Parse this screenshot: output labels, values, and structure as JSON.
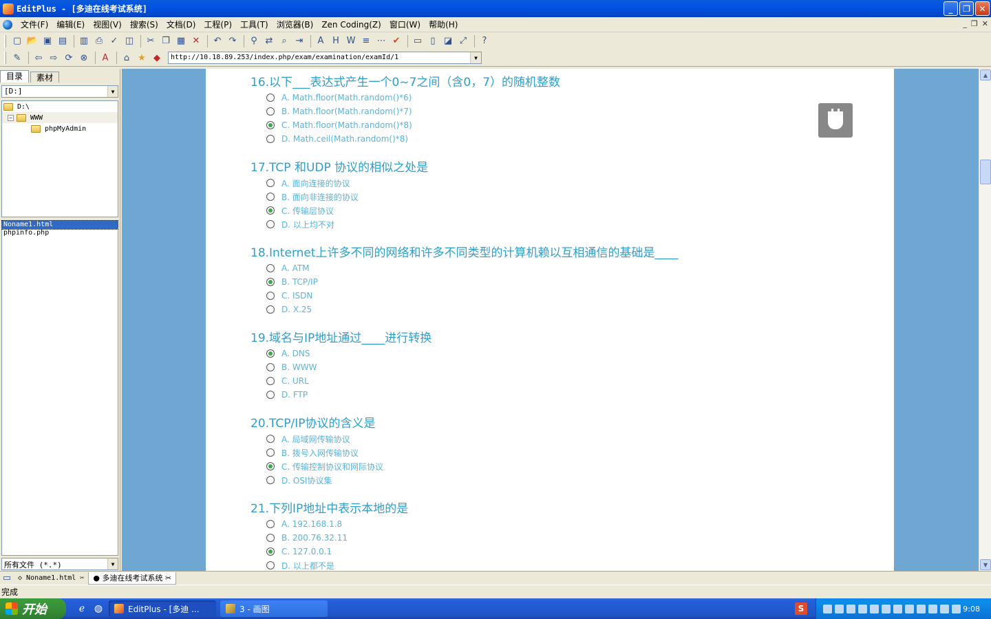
{
  "window": {
    "title": "EditPlus - [多迪在线考试系统]",
    "buttons": {
      "minimize": "_",
      "restore": "❐",
      "close": "✕"
    }
  },
  "menu": [
    "文件(F)",
    "编辑(E)",
    "视图(V)",
    "搜索(S)",
    "文档(D)",
    "工程(P)",
    "工具(T)",
    "浏览器(B)",
    "Zen Coding(Z)",
    "窗口(W)",
    "帮助(H)"
  ],
  "mdi_buttons": {
    "minimize": "_",
    "restore": "❐",
    "close": "✕"
  },
  "browser_bar": {
    "url": "http://10.18.89.253/index.php/exam/examination/examId/1"
  },
  "left_panel": {
    "tabs": [
      "目录",
      "素材"
    ],
    "drive": "[D:]",
    "tree": [
      {
        "label": "D:\\",
        "expander": ""
      },
      {
        "label": "WWW",
        "expander": "−"
      },
      {
        "label": "phpMyAdmin",
        "expander": ""
      }
    ],
    "files": [
      "Noname1.html",
      "phpinfo.php"
    ],
    "filter": "所有文件 (*.*)"
  },
  "questions": [
    {
      "title": "16.以下___表达式产生一个0~7之间（含0，7）的随机整数",
      "options": [
        {
          "text": "A. Math.floor(Math.random()*6)",
          "checked": false
        },
        {
          "text": "B. Math.floor(Math.random()*7)",
          "checked": false
        },
        {
          "text": "C. Math.floor(Math.random()*8)",
          "checked": true
        },
        {
          "text": "D. Math.ceil(Math.random()*8)",
          "checked": false
        }
      ]
    },
    {
      "title": "17.TCP 和UDP 协议的相似之处是",
      "options": [
        {
          "text": "A. 面向连接的协议",
          "checked": false
        },
        {
          "text": "B. 面向非连接的协议",
          "checked": false
        },
        {
          "text": "C. 传输层协议",
          "checked": true
        },
        {
          "text": "D. 以上均不对",
          "checked": false
        }
      ]
    },
    {
      "title": "18.Internet上许多不同的网络和许多不同类型的计算机赖以互相通信的基础是____",
      "options": [
        {
          "text": "A. ATM",
          "checked": false
        },
        {
          "text": "B. TCP/IP",
          "checked": true
        },
        {
          "text": "C. ISDN",
          "checked": false
        },
        {
          "text": "D. X.25",
          "checked": false
        }
      ]
    },
    {
      "title": "19.域名与IP地址通过____进行转换",
      "options": [
        {
          "text": "A. DNS",
          "checked": true
        },
        {
          "text": "B. WWW",
          "checked": false
        },
        {
          "text": "C. URL",
          "checked": false
        },
        {
          "text": "D. FTP",
          "checked": false
        }
      ]
    },
    {
      "title": "20.TCP/IP协议的含义是",
      "options": [
        {
          "text": "A. 局域网传输协议",
          "checked": false
        },
        {
          "text": "B. 拨号入网传输协议",
          "checked": false
        },
        {
          "text": "C. 传输控制协议和网际协议",
          "checked": true
        },
        {
          "text": "D. OSI协议集",
          "checked": false
        }
      ]
    },
    {
      "title": "21.下列IP地址中表示本地的是",
      "options": [
        {
          "text": "A. 192.168.1.8",
          "checked": false
        },
        {
          "text": "B. 200.76.32.11",
          "checked": false
        },
        {
          "text": "C. 127.0.0.1",
          "checked": true
        },
        {
          "text": "D. 以上都不是",
          "checked": false
        }
      ]
    }
  ],
  "doc_tabs": [
    "Noname1.html",
    "多迪在线考试系统"
  ],
  "status": "完成",
  "taskbar": {
    "start_label": "开始",
    "tasks": [
      "EditPlus - [多迪 ...",
      "3 - 画图"
    ],
    "ime_label": "S",
    "clock": "9:08"
  }
}
